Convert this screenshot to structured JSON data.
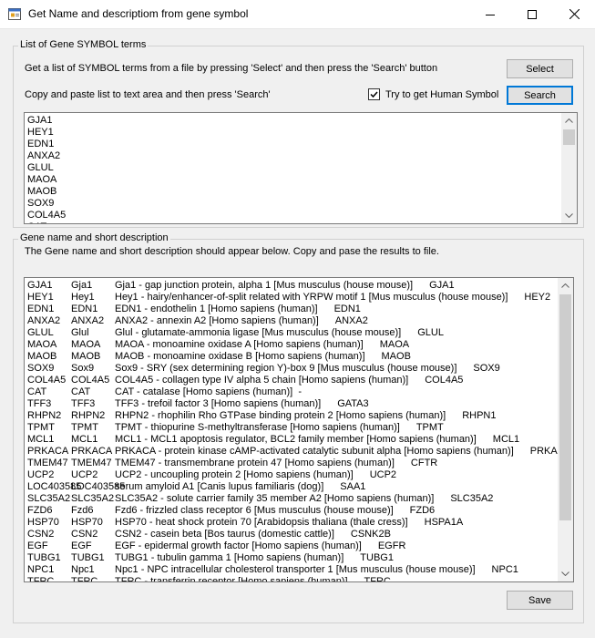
{
  "window": {
    "title": "Get Name and descriptiom from gene symbol"
  },
  "group1": {
    "title": "List of Gene SYMBOL terms",
    "instruction1": "Get a list of SYMBOL terms from a file by pressing 'Select' and then press the 'Search' button",
    "instruction2": "Copy and paste list to text area and then press 'Search'",
    "select_label": "Select",
    "search_label": "Search",
    "checkbox_label": "Try to get Human Symbol",
    "checkbox_checked": true,
    "symbols": [
      "GJA1",
      "HEY1",
      "EDN1",
      "ANXA2",
      "GLUL",
      "MAOA",
      "MAOB",
      "SOX9",
      "COL4A5",
      "CAT"
    ]
  },
  "group2": {
    "title": "Gene name and short description",
    "instruction": "The Gene name and short description should appear below. Copy and pase the results to file.",
    "results": [
      [
        "GJA1",
        "Gja1",
        "Gja1 - gap junction protein, alpha 1 [Mus musculus (house mouse)]",
        "GJA1"
      ],
      [
        "HEY1",
        "Hey1",
        "Hey1 - hairy/enhancer-of-split related with YRPW motif 1 [Mus musculus (house mouse)]",
        "HEY2"
      ],
      [
        "EDN1",
        "EDN1",
        "EDN1 - endothelin 1 [Homo sapiens (human)]",
        "EDN1"
      ],
      [
        "ANXA2",
        "ANXA2",
        "ANXA2 - annexin A2 [Homo sapiens (human)]",
        "ANXA2"
      ],
      [
        "GLUL",
        "Glul",
        "Glul - glutamate-ammonia ligase [Mus musculus (house mouse)]",
        "GLUL"
      ],
      [
        "MAOA",
        "MAOA",
        "MAOA - monoamine oxidase A [Homo sapiens (human)]",
        "MAOA"
      ],
      [
        "MAOB",
        "MAOB",
        "MAOB - monoamine oxidase B [Homo sapiens (human)]",
        "MAOB"
      ],
      [
        "SOX9",
        "Sox9",
        "Sox9 - SRY (sex determining region Y)-box 9 [Mus musculus (house mouse)]",
        "SOX9"
      ],
      [
        "COL4A5",
        "COL4A5",
        "COL4A5 - collagen type IV alpha 5 chain [Homo sapiens (human)]",
        "COL4A5"
      ],
      [
        "CAT",
        "CAT",
        "CAT - catalase [Homo sapiens (human)]  -",
        ""
      ],
      [
        "TFF3",
        "TFF3",
        "TFF3 - trefoil factor 3 [Homo sapiens (human)]",
        "GATA3"
      ],
      [
        "RHPN2",
        "RHPN2",
        "RHPN2 - rhophilin Rho GTPase binding protein 2 [Homo sapiens (human)]",
        "RHPN1"
      ],
      [
        "TPMT",
        "TPMT",
        "TPMT - thiopurine S-methyltransferase [Homo sapiens (human)]",
        "TPMT"
      ],
      [
        "MCL1",
        "MCL1",
        "MCL1 - MCL1 apoptosis regulator, BCL2 family member [Homo sapiens (human)]",
        "MCL1"
      ],
      [
        "PRKACA",
        "PRKACA",
        "PRKACA - protein kinase cAMP-activated catalytic subunit alpha [Homo sapiens (human)]",
        "PRKACA"
      ],
      [
        "TMEM47",
        "TMEM47",
        "TMEM47 - transmembrane protein 47 [Homo sapiens (human)]",
        "CFTR"
      ],
      [
        "UCP2",
        "UCP2",
        "UCP2 - uncoupling protein 2 [Homo sapiens (human)]",
        "UCP2"
      ],
      [
        "LOC403585",
        "LOC403585",
        "serum amyloid A1 [Canis lupus familiaris (dog)]",
        "SAA1"
      ],
      [
        "SLC35A2",
        "SLC35A2",
        "SLC35A2 - solute carrier family 35 member A2 [Homo sapiens (human)]",
        "SLC35A2"
      ],
      [
        "FZD6",
        "Fzd6",
        "Fzd6 - frizzled class receptor 6 [Mus musculus (house mouse)]",
        "FZD6"
      ],
      [
        "HSP70",
        "HSP70",
        "HSP70 - heat shock protein 70 [Arabidopsis thaliana (thale cress)]",
        "HSPA1A"
      ],
      [
        "CSN2",
        "CSN2",
        "CSN2 - casein beta [Bos taurus (domestic cattle)]",
        "CSNK2B"
      ],
      [
        "EGF",
        "EGF",
        "EGF - epidermal growth factor [Homo sapiens (human)]",
        "EGFR"
      ],
      [
        "TUBG1",
        "TUBG1",
        "TUBG1 - tubulin gamma 1 [Homo sapiens (human)]",
        "TUBG1"
      ],
      [
        "NPC1",
        "Npc1",
        "Npc1 - NPC intracellular cholesterol transporter 1 [Mus musculus (house mouse)]",
        "NPC1"
      ],
      [
        "TFRC",
        "TFRC",
        "TFRC - transferrin receptor [Homo sapiens (human)]",
        "TFRC"
      ]
    ],
    "save_label": "Save"
  }
}
